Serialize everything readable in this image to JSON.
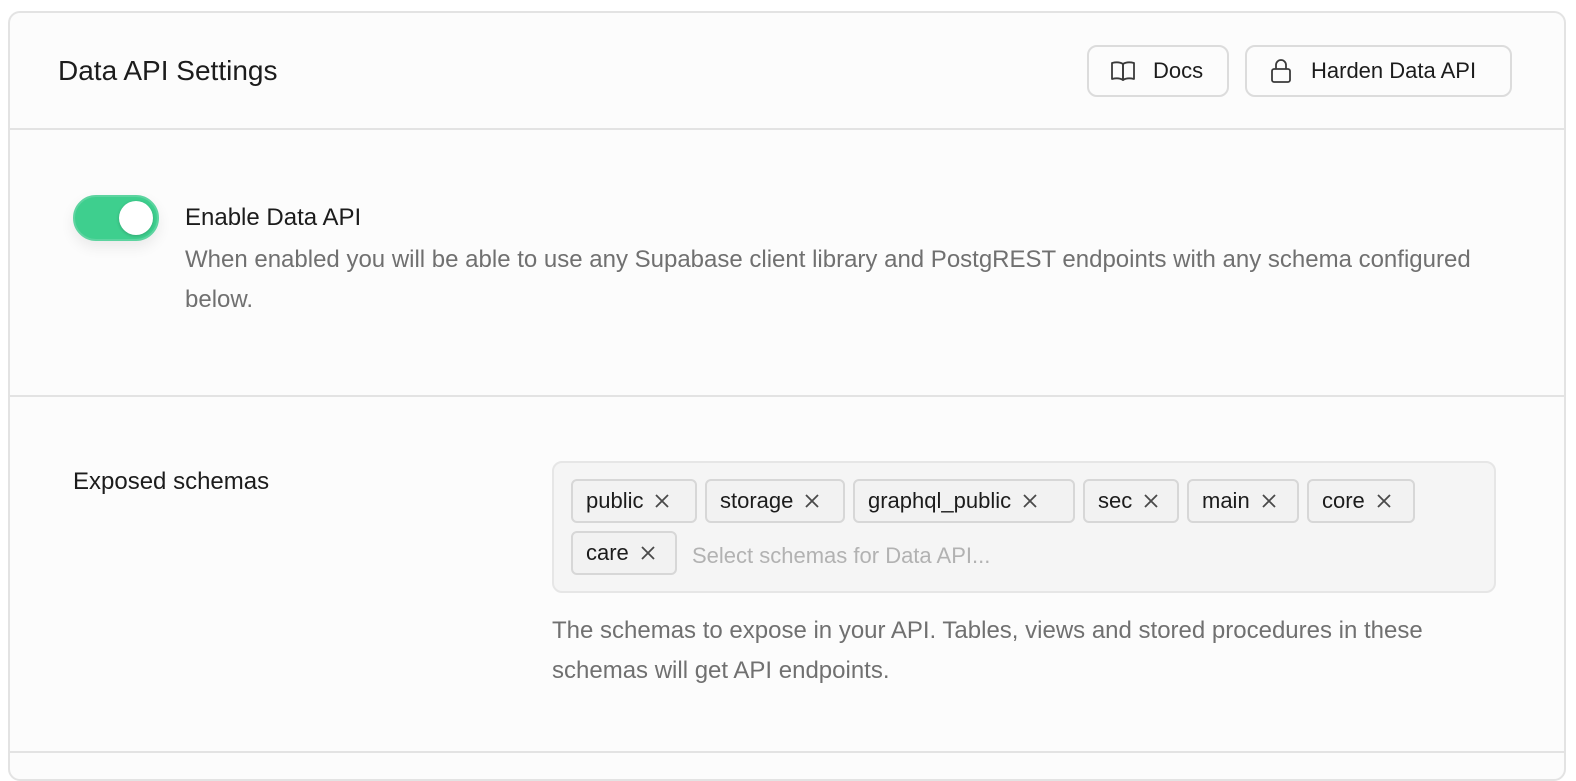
{
  "header": {
    "title": "Data API Settings",
    "docs_label": "Docs",
    "docs_icon": "book-open-icon",
    "harden_label": "Harden Data API",
    "harden_icon": "lock-icon"
  },
  "enable": {
    "enabled": true,
    "accent_color": "#3ecf8e",
    "label": "Enable Data API",
    "description": "When enabled you will be able to use any Supabase client library and PostgREST endpoints with any schema configured below."
  },
  "schemas": {
    "label": "Exposed schemas",
    "selected": [
      "public",
      "storage",
      "graphql_public",
      "sec",
      "main",
      "core",
      "care"
    ],
    "placeholder": "Select schemas for Data API...",
    "help": "The schemas to expose in your API. Tables, views and stored procedures in these schemas will get API endpoints."
  }
}
